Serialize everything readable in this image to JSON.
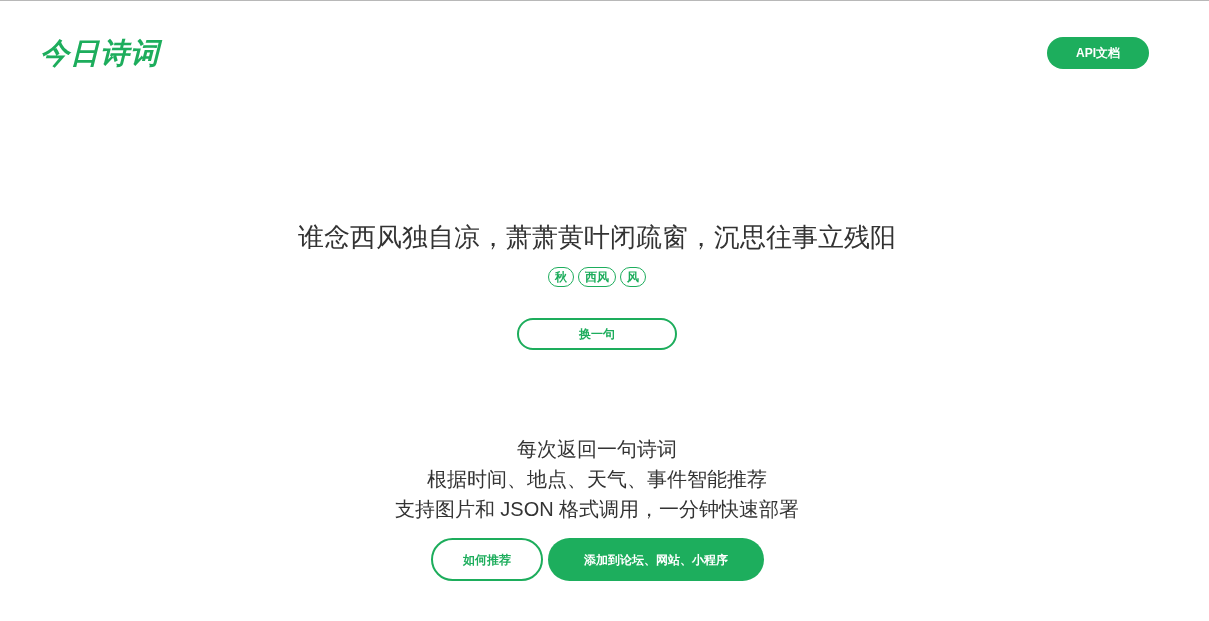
{
  "header": {
    "logo": "今日诗词",
    "api_button": "API文档"
  },
  "poem": {
    "line": "谁念西风独自凉，萧萧黄叶闭疏窗，沉思往事立残阳",
    "tags": [
      "秋",
      "西风",
      "风"
    ],
    "refresh_button": "换一句"
  },
  "features": [
    "每次返回一句诗词",
    "根据时间、地点、天气、事件智能推荐",
    "支持图片和 JSON 格式调用，一分钟快速部署"
  ],
  "actions": [
    {
      "label": "如何推荐",
      "kind": "outline"
    },
    {
      "label": "添加到论坛、网站、小程序",
      "kind": "filled"
    }
  ]
}
